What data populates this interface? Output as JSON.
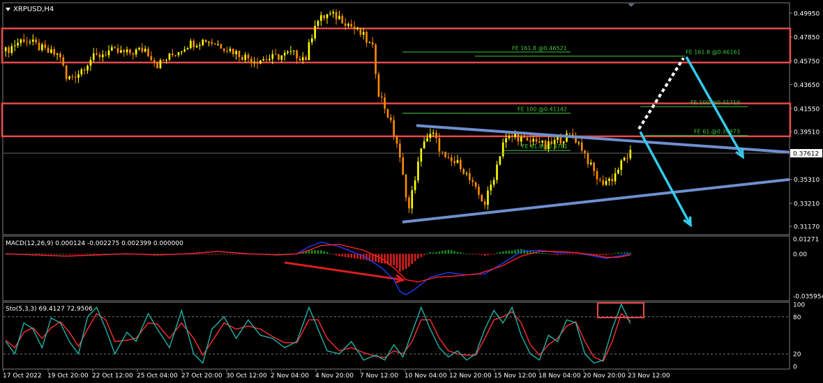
{
  "colors": {
    "background": "#000000",
    "frame": "#808080",
    "bull": "#FFFF00",
    "bear": "#FF8C00",
    "zone": "#E8484A",
    "trend": "#6F8FD0",
    "arrow": "#33CCEE",
    "dotted": "#FFFFFF",
    "fib": "#3CC83C",
    "macd_main": "#1E3CFF",
    "macd_signal": "#FF2020",
    "hist_pos": "#1E8C1E",
    "hist_neg": "#DC1E1E",
    "sto_main": "#20B2AA",
    "sto_signal": "#FF3030",
    "price_label_bg": "#FFFFFF"
  },
  "chart_data": [
    {
      "type": "candlestick",
      "title": "XRPUSD,H4",
      "ylim": [
        0.305,
        0.508
      ],
      "y_ticks": [
        "0.49950",
        "0.47850",
        "0.45750",
        "0.43650",
        "0.41550",
        "0.39510",
        "0.37612",
        "0.35310",
        "0.33210",
        "0.31170"
      ],
      "current_price": "0.37612",
      "x_ticks": [
        "17 Oct 2022",
        "19 Oct 20:00",
        "22 Oct 12:00",
        "25 Oct 04:00",
        "27 Oct 20:00",
        "30 Oct 12:00",
        "2 Nov 04:00",
        "4 Nov 20:00",
        "7 Nov 12:00",
        "10 Nov 04:00",
        "12 Nov 20:00",
        "15 Nov 12:00",
        "18 Nov 04:00",
        "20 Nov 20:00",
        "23 Nov 12:00"
      ],
      "close_path": [
        [
          0,
          0.466
        ],
        [
          3,
          0.472
        ],
        [
          6,
          0.477
        ],
        [
          10,
          0.471
        ],
        [
          14,
          0.465
        ],
        [
          18,
          0.462
        ],
        [
          20,
          0.441
        ],
        [
          24,
          0.447
        ],
        [
          28,
          0.459
        ],
        [
          34,
          0.466
        ],
        [
          40,
          0.464
        ],
        [
          46,
          0.468
        ],
        [
          50,
          0.454
        ],
        [
          54,
          0.461
        ],
        [
          60,
          0.472
        ],
        [
          66,
          0.476
        ],
        [
          72,
          0.47
        ],
        [
          78,
          0.462
        ],
        [
          82,
          0.458
        ],
        [
          88,
          0.46
        ],
        [
          94,
          0.464
        ],
        [
          99,
          0.46
        ],
        [
          102,
          0.491
        ],
        [
          106,
          0.498
        ],
        [
          110,
          0.496
        ],
        [
          114,
          0.488
        ],
        [
          118,
          0.479
        ],
        [
          121,
          0.468
        ],
        [
          123,
          0.43
        ],
        [
          126,
          0.41
        ],
        [
          129,
          0.385
        ],
        [
          131,
          0.355
        ],
        [
          133,
          0.327
        ],
        [
          135,
          0.355
        ],
        [
          138,
          0.389
        ],
        [
          141,
          0.392
        ],
        [
          145,
          0.37
        ],
        [
          150,
          0.366
        ],
        [
          155,
          0.343
        ],
        [
          158,
          0.332
        ],
        [
          161,
          0.356
        ],
        [
          164,
          0.386
        ],
        [
          168,
          0.392
        ],
        [
          172,
          0.385
        ],
        [
          175,
          0.389
        ],
        [
          178,
          0.381
        ],
        [
          182,
          0.388
        ],
        [
          187,
          0.392
        ],
        [
          190,
          0.381
        ],
        [
          193,
          0.364
        ],
        [
          196,
          0.35
        ],
        [
          200,
          0.354
        ],
        [
          204,
          0.371
        ],
        [
          206,
          0.376
        ]
      ],
      "support_zones": [
        [
          0.456,
          0.486
        ],
        [
          0.391,
          0.42
        ]
      ],
      "fib_levels": [
        {
          "label": "FE 161.8 @0.46521",
          "price": 0.46521
        },
        {
          "label": "FE 161.8 @0.46161",
          "price": 0.46161
        },
        {
          "label": "FE 100 @0.41142",
          "price": 0.41142
        },
        {
          "label": "FE 100 @0.41719",
          "price": 0.41719
        },
        {
          "label": "FE 61.@0.39973",
          "price": 0.39173
        },
        {
          "label": "FE 61.8@0.3781",
          "price": 0.3785
        }
      ]
    },
    {
      "type": "line",
      "title": "MACD(12,26,9) 0.000124 -0.002275 0.002399 0.000000",
      "ylim": [
        -0.0395,
        0.0145
      ],
      "y_ticks": [
        "0.01271",
        "0.00",
        "-0.035954"
      ],
      "series": [
        {
          "name": "main",
          "values": [
            [
              0,
              0.0
            ],
            [
              10,
              -0.001
            ],
            [
              20,
              -0.002
            ],
            [
              30,
              -0.001
            ],
            [
              40,
              0.0
            ],
            [
              50,
              -0.001
            ],
            [
              60,
              0.0
            ],
            [
              70,
              0.002
            ],
            [
              80,
              0.0
            ],
            [
              90,
              -0.001
            ],
            [
              96,
              0.0
            ],
            [
              100,
              0.006
            ],
            [
              104,
              0.01
            ],
            [
              110,
              0.006
            ],
            [
              118,
              -0.002
            ],
            [
              124,
              -0.012
            ],
            [
              128,
              -0.022
            ],
            [
              130,
              -0.032
            ],
            [
              132,
              -0.035
            ],
            [
              135,
              -0.03
            ],
            [
              140,
              -0.02
            ],
            [
              146,
              -0.016
            ],
            [
              152,
              -0.018
            ],
            [
              158,
              -0.017
            ],
            [
              164,
              -0.008
            ],
            [
              170,
              0.002
            ],
            [
              176,
              0.003
            ],
            [
              182,
              0.001
            ],
            [
              188,
              0.001
            ],
            [
              194,
              -0.002
            ],
            [
              198,
              -0.004
            ],
            [
              202,
              -0.002
            ],
            [
              206,
              0.0
            ]
          ]
        },
        {
          "name": "signal",
          "values": [
            [
              0,
              0.0
            ],
            [
              10,
              -0.001
            ],
            [
              20,
              -0.002
            ],
            [
              30,
              -0.001
            ],
            [
              40,
              0.0
            ],
            [
              50,
              -0.001
            ],
            [
              60,
              0.0
            ],
            [
              70,
              0.002
            ],
            [
              80,
              0.0
            ],
            [
              90,
              -0.001
            ],
            [
              96,
              0.0
            ],
            [
              100,
              0.003
            ],
            [
              104,
              0.007
            ],
            [
              110,
              0.008
            ],
            [
              118,
              0.003
            ],
            [
              124,
              -0.004
            ],
            [
              128,
              -0.012
            ],
            [
              132,
              -0.022
            ],
            [
              136,
              -0.024
            ],
            [
              142,
              -0.02
            ],
            [
              148,
              -0.019
            ],
            [
              156,
              -0.017
            ],
            [
              164,
              -0.01
            ],
            [
              170,
              -0.002
            ],
            [
              176,
              0.002
            ],
            [
              182,
              0.002
            ],
            [
              188,
              0.001
            ],
            [
              194,
              -0.001
            ],
            [
              198,
              -0.003
            ],
            [
              202,
              -0.003
            ],
            [
              206,
              -0.001
            ]
          ]
        }
      ]
    },
    {
      "type": "line",
      "title": "Sto(5,3,3) 69.4127 72.9506",
      "ylim": [
        0,
        100
      ],
      "y_ticks": [
        "100",
        "80",
        "20",
        "0"
      ],
      "series": [
        {
          "name": "main",
          "values": [
            [
              0,
              40
            ],
            [
              3,
              20
            ],
            [
              6,
              70
            ],
            [
              9,
              60
            ],
            [
              12,
              30
            ],
            [
              15,
              78
            ],
            [
              18,
              70
            ],
            [
              21,
              40
            ],
            [
              24,
              20
            ],
            [
              27,
              80
            ],
            [
              30,
              95
            ],
            [
              33,
              60
            ],
            [
              36,
              20
            ],
            [
              40,
              55
            ],
            [
              43,
              40
            ],
            [
              47,
              85
            ],
            [
              50,
              60
            ],
            [
              54,
              30
            ],
            [
              58,
              90
            ],
            [
              62,
              20
            ],
            [
              65,
              5
            ],
            [
              68,
              60
            ],
            [
              72,
              80
            ],
            [
              76,
              45
            ],
            [
              80,
              75
            ],
            [
              84,
              50
            ],
            [
              88,
              45
            ],
            [
              92,
              30
            ],
            [
              96,
              40
            ],
            [
              100,
              95
            ],
            [
              103,
              60
            ],
            [
              106,
              25
            ],
            [
              110,
              20
            ],
            [
              114,
              40
            ],
            [
              118,
              10
            ],
            [
              122,
              18
            ],
            [
              125,
              10
            ],
            [
              128,
              35
            ],
            [
              131,
              15
            ],
            [
              134,
              55
            ],
            [
              137,
              95
            ],
            [
              140,
              60
            ],
            [
              143,
              30
            ],
            [
              146,
              15
            ],
            [
              149,
              25
            ],
            [
              152,
              10
            ],
            [
              155,
              20
            ],
            [
              158,
              60
            ],
            [
              161,
              90
            ],
            [
              164,
              70
            ],
            [
              167,
              95
            ],
            [
              170,
              50
            ],
            [
              173,
              20
            ],
            [
              176,
              10
            ],
            [
              179,
              50
            ],
            [
              182,
              40
            ],
            [
              185,
              75
            ],
            [
              188,
              70
            ],
            [
              191,
              20
            ],
            [
              194,
              5
            ],
            [
              197,
              10
            ],
            [
              200,
              60
            ],
            [
              203,
              100
            ],
            [
              206,
              69
            ]
          ]
        },
        {
          "name": "signal",
          "values": [
            [
              0,
              42
            ],
            [
              3,
              30
            ],
            [
              6,
              55
            ],
            [
              9,
              62
            ],
            [
              12,
              45
            ],
            [
              15,
              62
            ],
            [
              18,
              72
            ],
            [
              21,
              55
            ],
            [
              24,
              32
            ],
            [
              27,
              60
            ],
            [
              30,
              85
            ],
            [
              33,
              75
            ],
            [
              36,
              40
            ],
            [
              40,
              42
            ],
            [
              43,
              45
            ],
            [
              47,
              70
            ],
            [
              50,
              68
            ],
            [
              54,
              45
            ],
            [
              58,
              70
            ],
            [
              62,
              45
            ],
            [
              65,
              18
            ],
            [
              68,
              40
            ],
            [
              72,
              70
            ],
            [
              76,
              60
            ],
            [
              80,
              65
            ],
            [
              84,
              60
            ],
            [
              88,
              48
            ],
            [
              92,
              38
            ],
            [
              96,
              38
            ],
            [
              100,
              75
            ],
            [
              103,
              75
            ],
            [
              106,
              45
            ],
            [
              110,
              25
            ],
            [
              114,
              30
            ],
            [
              118,
              22
            ],
            [
              122,
              16
            ],
            [
              125,
              14
            ],
            [
              128,
              25
            ],
            [
              131,
              20
            ],
            [
              134,
              40
            ],
            [
              137,
              75
            ],
            [
              140,
              75
            ],
            [
              143,
              45
            ],
            [
              146,
              25
            ],
            [
              149,
              20
            ],
            [
              152,
              18
            ],
            [
              155,
              18
            ],
            [
              158,
              45
            ],
            [
              161,
              75
            ],
            [
              164,
              80
            ],
            [
              167,
              88
            ],
            [
              170,
              70
            ],
            [
              173,
              35
            ],
            [
              176,
              18
            ],
            [
              179,
              35
            ],
            [
              182,
              45
            ],
            [
              185,
              65
            ],
            [
              188,
              72
            ],
            [
              191,
              40
            ],
            [
              194,
              15
            ],
            [
              197,
              8
            ],
            [
              200,
              40
            ],
            [
              203,
              85
            ],
            [
              206,
              73
            ]
          ]
        }
      ]
    }
  ]
}
